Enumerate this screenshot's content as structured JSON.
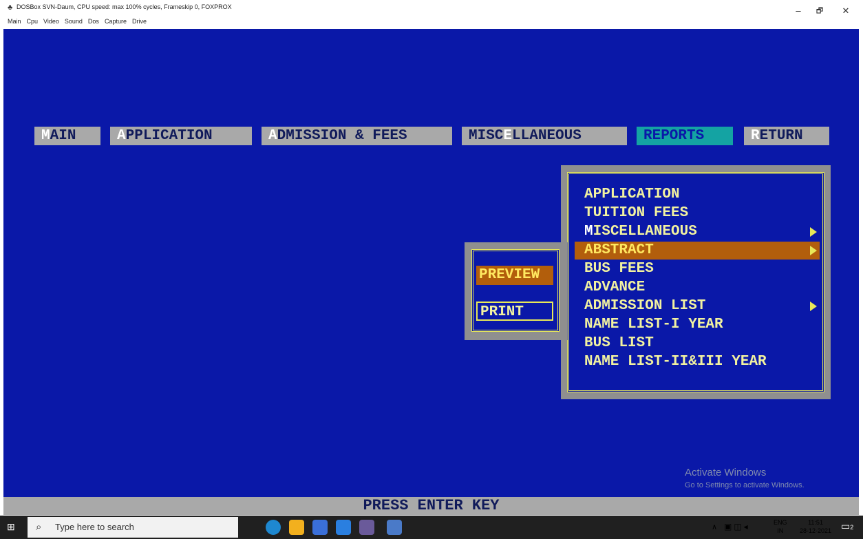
{
  "window": {
    "title": "DOSBox SVN-Daum, CPU speed: max 100% cycles, Frameskip 0, FOXPROX",
    "menu": [
      "Main",
      "Cpu",
      "Video",
      "Sound",
      "Dos",
      "Capture",
      "Drive"
    ],
    "minimize_glyph": "–",
    "maximize_glyph": "🗗",
    "close_glyph": "✕"
  },
  "menubar": {
    "main": {
      "hot": "M",
      "rest": "AIN"
    },
    "application": {
      "hot": "A",
      "rest": "PPLICATION"
    },
    "admission": {
      "hot": "A",
      "rest": "DMISSION & FEES"
    },
    "misc": {
      "pre": "MISC",
      "hot": "E",
      "rest": "LLANEOUS"
    },
    "reports": {
      "label": "REPORTS"
    },
    "return": {
      "hot": "R",
      "rest": "ETURN"
    }
  },
  "reports_menu": {
    "items": [
      {
        "label": "APPLICATION"
      },
      {
        "label": "TUITION FEES"
      },
      {
        "hot": "M",
        "rest": "ISCELLANEOUS"
      },
      {
        "label": "ABSTRACT"
      },
      {
        "label": "BUS FEES"
      },
      {
        "label": "ADVANCE"
      },
      {
        "label": "ADMISSION LIST"
      },
      {
        "label": "NAME LIST-I YEAR"
      },
      {
        "label": "BUS LIST"
      },
      {
        "label": "NAME LIST-II&III YEAR"
      }
    ],
    "selected": "ABSTRACT"
  },
  "output_menu": {
    "preview": "PREVIEW",
    "print": "PRINT"
  },
  "status_bar": "PRESS ENTER KEY",
  "watermark": {
    "title": "Activate Windows",
    "subtitle": "Go to Settings to activate Windows."
  },
  "taskbar": {
    "search_placeholder": "Type here to search",
    "lang_top": "ENG",
    "lang_bottom": "IN",
    "time": "11:51",
    "date": "28-12-2021",
    "notifications": "2"
  },
  "colors": {
    "dos_blue": "#0a18a8",
    "menu_gray": "#a9a9a9",
    "highlight_cyan": "#14a3a3",
    "selection_orange": "#b25e0c",
    "text_yellow": "#f2f2a0"
  }
}
